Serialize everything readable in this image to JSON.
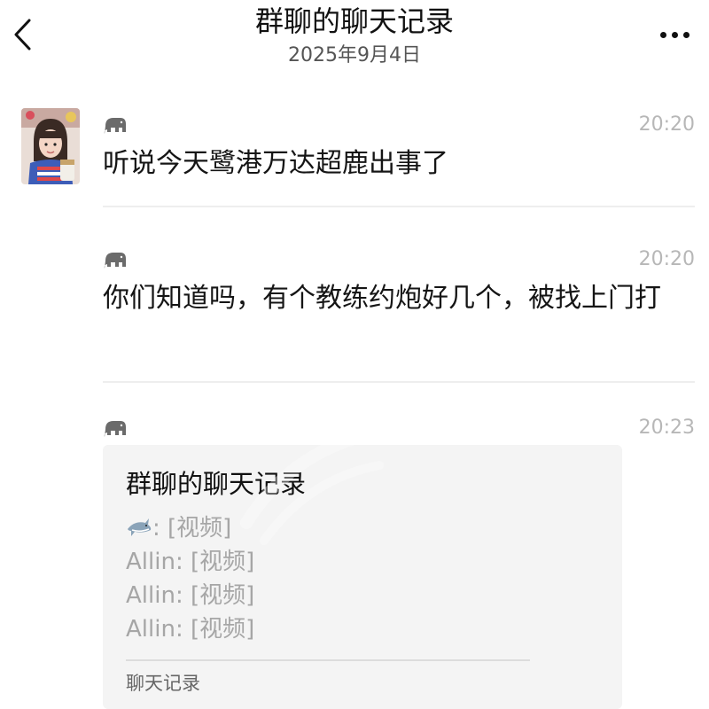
{
  "header": {
    "title": "群聊的聊天记录",
    "subtitle": "2025年9月4日"
  },
  "messages": [
    {
      "sender_icon": "elephant-icon",
      "time": "20:20",
      "text": "听说今天鹭港万达超鹿出事了"
    },
    {
      "sender_icon": "elephant-icon",
      "time": "20:20",
      "text": "你们知道吗，有个教练约炮好几个，被找上门打"
    },
    {
      "sender_icon": "elephant-icon",
      "time": "20:23",
      "record": {
        "title": "群聊的聊天记录",
        "lines": [
          {
            "sender": "",
            "sender_icon": "shark-icon",
            "sep": ": ",
            "content": "[视频]"
          },
          {
            "sender": "Allin",
            "sep": ": ",
            "content": "[视频]"
          },
          {
            "sender": "Allin",
            "sep": ": ",
            "content": "[视频]"
          },
          {
            "sender": "Allin",
            "sep": ": ",
            "content": "[视频]"
          }
        ],
        "footer": "聊天记录"
      }
    }
  ],
  "colors": {
    "text": "#151515",
    "time": "#b7b7b7",
    "card_bg": "#f4f4f4",
    "record_line": "#a6a6a6",
    "divider": "#eeeeee"
  }
}
